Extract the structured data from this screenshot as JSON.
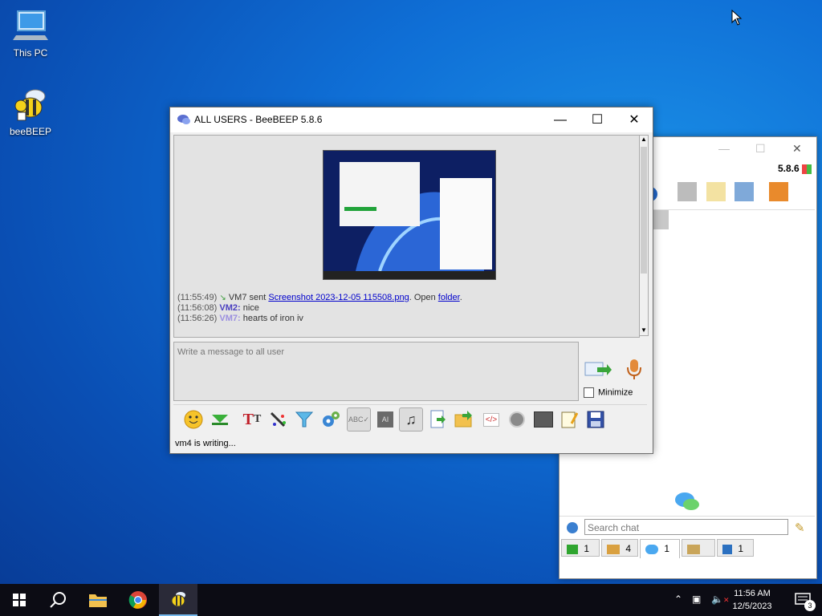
{
  "desktop": {
    "icons": [
      {
        "label": "This PC",
        "icon": "computer-icon"
      },
      {
        "label": "beeBEEP",
        "icon": "bee-icon"
      }
    ]
  },
  "back_window": {
    "version": "5.8.6",
    "search_placeholder": "Search chat",
    "tabs": [
      {
        "icon": "users-online-icon",
        "count": "1"
      },
      {
        "icon": "groups-icon",
        "count": "4"
      },
      {
        "icon": "chat-icon",
        "count": "1"
      },
      {
        "icon": "people-icon",
        "count": ""
      },
      {
        "icon": "share-icon",
        "count": "1"
      }
    ]
  },
  "main_window": {
    "title": "ALL USERS - BeeBEEP 5.8.6",
    "messages": [
      {
        "time": "(11:55:49)",
        "sender": "VM7",
        "text_prefix": " sent ",
        "file_link": "Screenshot 2023-12-05 115508.png",
        "text_mid": ". Open ",
        "folder_link": "folder",
        "text_suffix": "."
      },
      {
        "time": "(11:56:08)",
        "sender": "VM2:",
        "text": " nice",
        "sender_color": "#4a3fc0"
      },
      {
        "time": "(11:56:26)",
        "sender": "VM7:",
        "text": " hearts of iron iv",
        "sender_color": "#9b8fe0"
      }
    ],
    "input_placeholder": "Write a message to all user",
    "minimize_label": "Minimize",
    "minimize_checked": false,
    "status": "vm4 is writing...",
    "toolbar_icons": [
      "emoticon-icon",
      "download-icon",
      "font-icon",
      "color-pen-icon",
      "filter-icon",
      "settings-gears-icon",
      "spellcheck-icon",
      "abc-icon",
      "music-note-icon",
      "send-file-icon",
      "send-folder-icon",
      "code-icon",
      "record-icon",
      "screenshot-icon",
      "notes-icon",
      "save-icon"
    ]
  },
  "taskbar": {
    "time": "11:56 AM",
    "date": "12/5/2023",
    "notification_count": "3",
    "apps": [
      "start-icon",
      "search-icon",
      "file-explorer-icon",
      "chrome-icon",
      "beebeep-icon"
    ]
  }
}
